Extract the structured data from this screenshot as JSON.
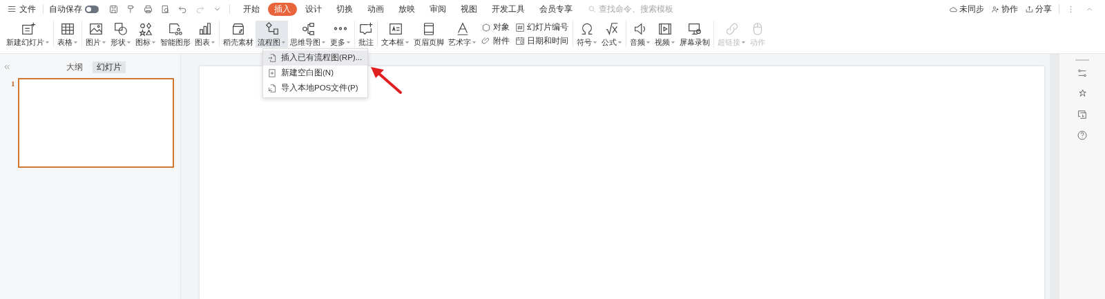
{
  "menu_bar": {
    "file_label": "文件",
    "autosave_label": "自动保存",
    "autosave_on": false,
    "tabs": [
      {
        "label": "开始",
        "selected": false
      },
      {
        "label": "插入",
        "selected": true
      },
      {
        "label": "设计",
        "selected": false
      },
      {
        "label": "切换",
        "selected": false
      },
      {
        "label": "动画",
        "selected": false
      },
      {
        "label": "放映",
        "selected": false
      },
      {
        "label": "审阅",
        "selected": false
      },
      {
        "label": "视图",
        "selected": false
      },
      {
        "label": "开发工具",
        "selected": false
      },
      {
        "label": "会员专享",
        "selected": false
      }
    ],
    "search": {
      "placeholder": "查找命令、搜索模板"
    },
    "actions": [
      "未同步",
      "协作",
      "分享"
    ]
  },
  "ribbon": [
    {
      "items": [
        {
          "kind": "big",
          "label": "新建幻灯片",
          "dropdown": true,
          "disabled": false,
          "selected": false
        }
      ]
    },
    {
      "items": [
        {
          "kind": "big",
          "label": "表格",
          "dropdown": true,
          "disabled": false,
          "selected": false
        }
      ]
    },
    {
      "items": [
        {
          "kind": "big",
          "label": "图片",
          "dropdown": true,
          "disabled": false,
          "selected": false
        },
        {
          "kind": "big",
          "label": "形状",
          "dropdown": true,
          "disabled": false,
          "selected": false
        },
        {
          "kind": "big",
          "label": "图标",
          "dropdown": true,
          "disabled": false,
          "selected": false
        },
        {
          "kind": "big",
          "label": "智能图形",
          "dropdown": false,
          "disabled": false,
          "selected": false
        },
        {
          "kind": "big",
          "label": "图表",
          "dropdown": true,
          "disabled": false,
          "selected": false
        }
      ]
    },
    {
      "items": [
        {
          "kind": "big",
          "label": "稻壳素材",
          "dropdown": false,
          "disabled": false,
          "selected": false
        },
        {
          "kind": "big",
          "label": "流程图",
          "dropdown": true,
          "disabled": false,
          "selected": true
        },
        {
          "kind": "big",
          "label": "思维导图",
          "dropdown": true,
          "disabled": false,
          "selected": false
        },
        {
          "kind": "big",
          "label": "更多",
          "dropdown": true,
          "disabled": false,
          "selected": false
        }
      ]
    },
    {
      "items": [
        {
          "kind": "big",
          "label": "批注",
          "dropdown": false,
          "disabled": false,
          "selected": false
        }
      ]
    },
    {
      "items": [
        {
          "kind": "big",
          "label": "文本框",
          "dropdown": true,
          "disabled": false,
          "selected": false
        },
        {
          "kind": "big",
          "label": "页眉页脚",
          "dropdown": false,
          "disabled": false,
          "selected": false
        },
        {
          "kind": "big",
          "label": "艺术字",
          "dropdown": true,
          "disabled": false,
          "selected": false
        },
        {
          "kind": "pair",
          "labels": [
            "对象",
            "附件"
          ],
          "disabled": false
        },
        {
          "kind": "pair",
          "labels": [
            "幻灯片编号",
            "日期和时间"
          ],
          "disabled": false
        }
      ]
    },
    {
      "items": [
        {
          "kind": "big",
          "label": "符号",
          "dropdown": true,
          "disabled": false,
          "selected": false
        },
        {
          "kind": "big",
          "label": "公式",
          "dropdown": true,
          "disabled": false,
          "selected": false
        }
      ]
    },
    {
      "items": [
        {
          "kind": "big",
          "label": "音频",
          "dropdown": true,
          "disabled": false,
          "selected": false
        },
        {
          "kind": "big",
          "label": "视频",
          "dropdown": true,
          "disabled": false,
          "selected": false
        },
        {
          "kind": "big",
          "label": "屏幕录制",
          "dropdown": false,
          "disabled": false,
          "selected": false
        }
      ]
    },
    {
      "items": [
        {
          "kind": "big",
          "label": "超链接",
          "dropdown": true,
          "disabled": true,
          "selected": false
        },
        {
          "kind": "big",
          "label": "动作",
          "dropdown": false,
          "disabled": true,
          "selected": false
        }
      ]
    }
  ],
  "dropdown_menu": [
    {
      "label": "插入已有流程图(RP)...",
      "selected": true
    },
    {
      "label": "新建空白图(N)",
      "selected": false
    },
    {
      "label": "导入本地POS文件(P)",
      "selected": false
    }
  ],
  "left_panel": {
    "tabs": [
      {
        "label": "大纲",
        "selected": false
      },
      {
        "label": "幻灯片",
        "selected": true
      }
    ],
    "slides": [
      {
        "number": "1",
        "selected": true
      }
    ]
  }
}
